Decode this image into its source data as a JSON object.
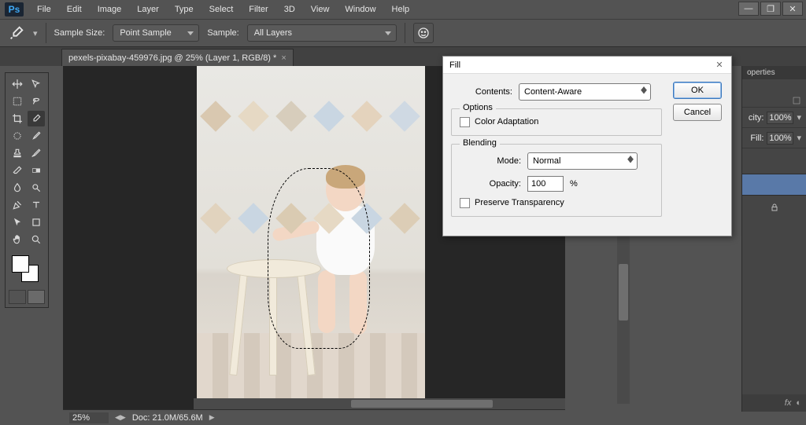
{
  "app": {
    "logo": "Ps"
  },
  "menu": [
    "File",
    "Edit",
    "Image",
    "Layer",
    "Type",
    "Select",
    "Filter",
    "3D",
    "View",
    "Window",
    "Help"
  ],
  "options_bar": {
    "sample_size_label": "Sample Size:",
    "sample_size_value": "Point Sample",
    "sample_label": "Sample:",
    "sample_value": "All Layers"
  },
  "document": {
    "tab_title": "pexels-pixabay-459976.jpg @ 25% (Layer 1, RGB/8) *",
    "zoom": "25%",
    "doc_info": "Doc: 21.0M/65.6M"
  },
  "right_panel": {
    "properties_tab": "operties",
    "opacity_label": "city:",
    "opacity_value": "100%",
    "fill_label": "Fill:",
    "fill_value": "100%",
    "fx_label": "fx"
  },
  "dialog": {
    "title": "Fill",
    "contents_label": "Contents:",
    "contents_value": "Content-Aware",
    "options_legend": "Options",
    "color_adaptation": "Color Adaptation",
    "blending_legend": "Blending",
    "mode_label": "Mode:",
    "mode_value": "Normal",
    "opacity_label": "Opacity:",
    "opacity_value": "100",
    "opacity_unit": "%",
    "preserve_transparency": "Preserve Transparency",
    "ok": "OK",
    "cancel": "Cancel"
  },
  "flags": {
    "row1": [
      "#d9c8b0",
      "#e6d9c4",
      "#d7cdbc",
      "#c9d6e2",
      "#e4d3bd",
      "#cfd9e3"
    ],
    "row2": [
      "#e1d3be",
      "#c9d6e2",
      "#dacbb2",
      "#e6d9c4",
      "#c9d6e2",
      "#dccdb6"
    ]
  }
}
